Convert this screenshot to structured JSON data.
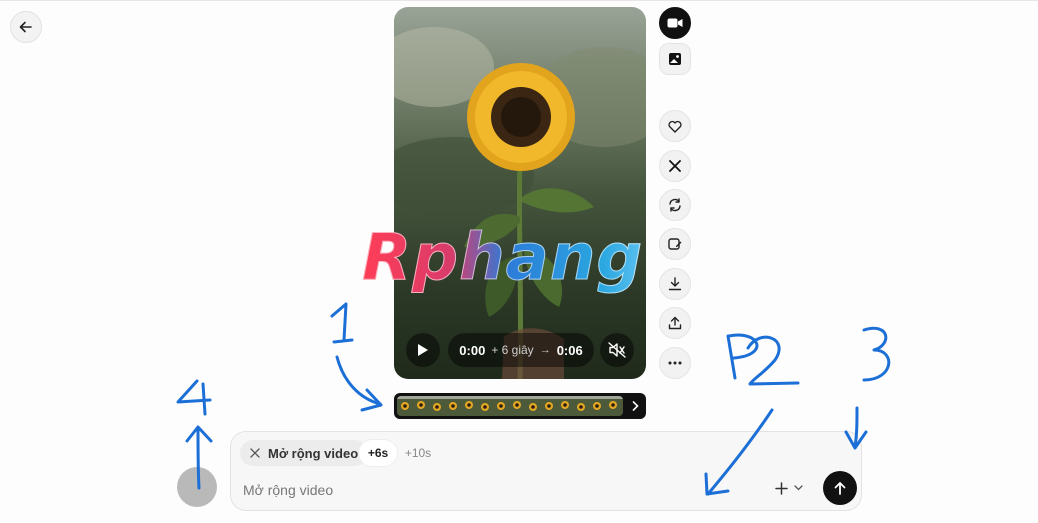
{
  "video": {
    "time_current": "0:00",
    "time_extra": "+ 6 giây",
    "time_end": "0:06"
  },
  "composer": {
    "mode_chip": "Mở rộng video",
    "option_6s": "+6s",
    "option_10s": "+10s",
    "placeholder": "Mở rộng video"
  },
  "watermark": "Rphang",
  "annotations": [
    "1",
    "P2",
    "3",
    "4"
  ],
  "icons": {
    "back": "arrow-left-icon",
    "video_mode": "video-camera-icon",
    "image_mode": "image-icon",
    "like": "heart-icon",
    "x_share": "x-logo-icon",
    "remix": "refresh-icon",
    "edit_image": "image-edit-icon",
    "download": "download-icon",
    "share": "share-icon",
    "more": "more-horizontal-icon",
    "play": "play-icon",
    "mute": "volume-mute-icon",
    "add": "plus-icon",
    "send": "arrow-up-icon"
  },
  "colors": {
    "annotation_ink": "#1c6fd6",
    "send_button": "#111111"
  }
}
